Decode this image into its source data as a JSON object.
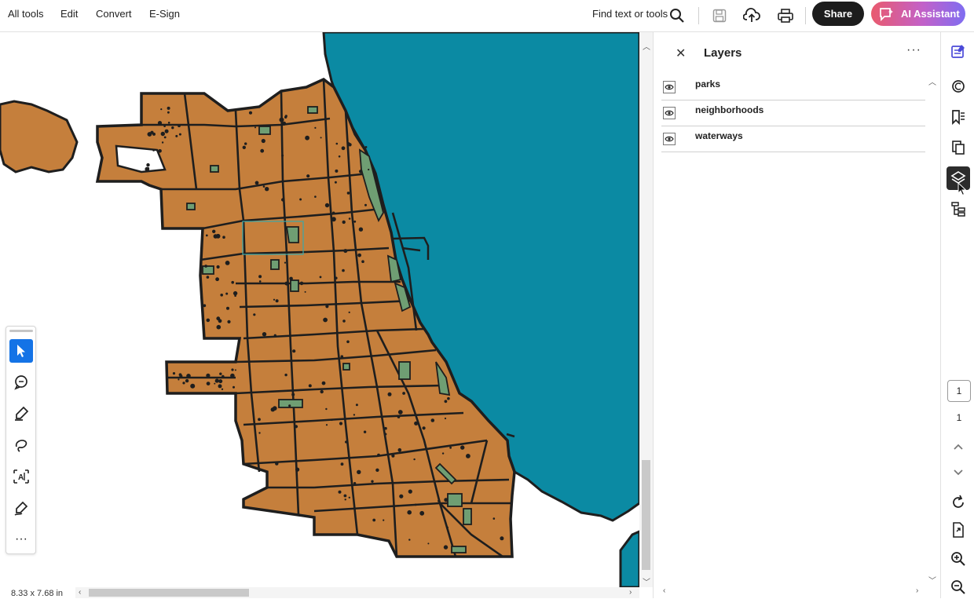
{
  "menu": {
    "all_tools": "All tools",
    "edit": "Edit",
    "convert": "Convert",
    "esign": "E-Sign"
  },
  "toolbar": {
    "find_label": "Find text or tools",
    "icons": [
      "search-icon",
      "save-icon",
      "cloud-upload-icon",
      "print-icon"
    ],
    "share_label": "Share",
    "ai_label": "AI Assistant"
  },
  "document": {
    "page_size": "8.33 x 7.68 in",
    "colors": {
      "water": "#0b8aa3",
      "land": "#c57f3c",
      "park": "#6f9e73",
      "outline": "#1e1e1e"
    }
  },
  "tools": [
    "select-tool-icon",
    "comment-icon",
    "highlighter-icon",
    "draw-freeform-icon",
    "text-recognition-icon",
    "sign-pen-icon",
    "more-tools-icon"
  ],
  "layers_panel": {
    "title": "Layers",
    "layers": [
      {
        "label": "parks",
        "visible": true
      },
      {
        "label": "neighborhoods",
        "visible": true
      },
      {
        "label": "waterways",
        "visible": true
      }
    ]
  },
  "rail": {
    "icons": [
      "edit-pdf-icon",
      "comments-icon",
      "bookmarks-icon",
      "pages-icon",
      "layers-icon",
      "tags-icon"
    ],
    "active": "layers-icon",
    "current_page": "1",
    "total_pages": "1",
    "bottom_icons": [
      "prev-page-icon",
      "next-page-icon",
      "rotate-icon",
      "extract-icon",
      "zoom-in-icon",
      "zoom-out-icon"
    ]
  }
}
